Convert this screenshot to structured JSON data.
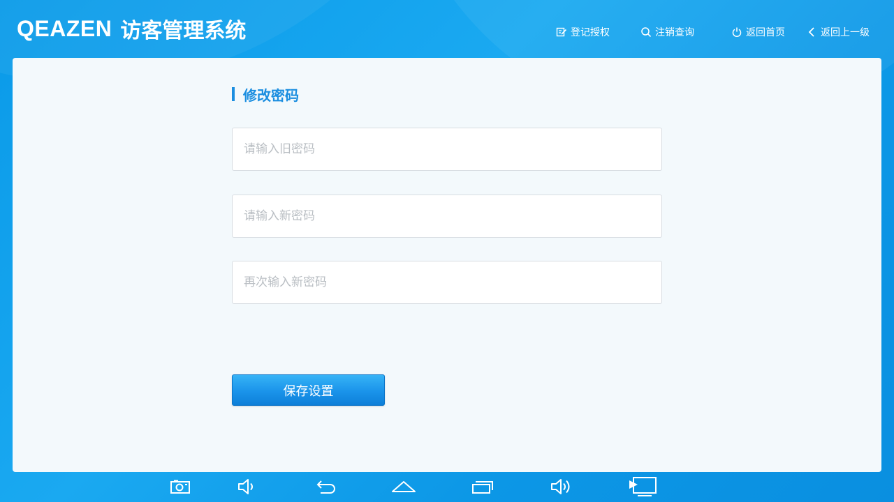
{
  "header": {
    "brand_logo": "QEAZEN",
    "brand_title": "访客管理系统",
    "nav": {
      "register": {
        "label": "登记授权",
        "icon": "edit-icon"
      },
      "query": {
        "label": "注销查询",
        "icon": "search-icon"
      },
      "home": {
        "label": "返回首页",
        "icon": "power-icon"
      },
      "back": {
        "label": "返回上一级",
        "icon": "chevron-left-icon"
      }
    }
  },
  "form": {
    "title": "修改密码",
    "old_password": {
      "value": "",
      "placeholder": "请输入旧密码"
    },
    "new_password": {
      "value": "",
      "placeholder": "请输入新密码"
    },
    "confirm_password": {
      "value": "",
      "placeholder": "再次输入新密码"
    },
    "save_label": "保存设置"
  },
  "system_bar": {
    "icons": [
      "screenshot-icon",
      "volume-down-icon",
      "back-icon",
      "home-icon",
      "recent-apps-icon",
      "volume-up-icon",
      "screen-cast-icon"
    ]
  },
  "colors": {
    "header_bg": "#0c9ae8",
    "accent": "#1b8ee0",
    "panel_bg": "#f3f9fc",
    "button_bg": "#1a93ea",
    "placeholder": "#b9bec3"
  }
}
